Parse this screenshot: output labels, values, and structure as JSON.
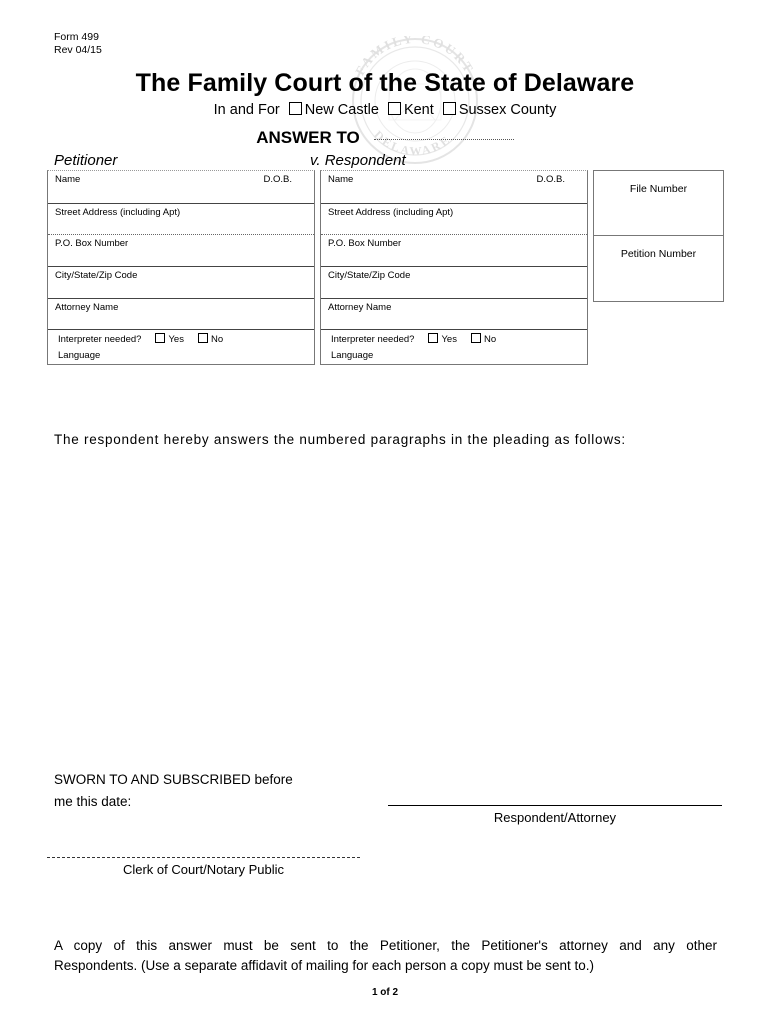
{
  "form": {
    "number": "Form 499",
    "revision": "Rev 04/15"
  },
  "header": {
    "title": "The Family Court of the State of Delaware",
    "county_prefix": "In and For",
    "counties": [
      "New Castle",
      "Kent",
      "Sussex County"
    ],
    "answer_to_label": "ANSWER TO",
    "seal_text_top": "FAMILY COURT",
    "seal_text_bottom": "DELAWARE"
  },
  "parties": {
    "petitioner_label": "Petitioner",
    "respondent_label": "v. Respondent",
    "fields": {
      "name": "Name",
      "dob": "D.O.B.",
      "street": "Street Address  (including Apt)",
      "po_box": "P.O. Box Number",
      "city_state_zip": "City/State/Zip Code",
      "attorney": "Attorney Name",
      "interpreter": "Interpreter needed?",
      "yes": "Yes",
      "no": "No",
      "language": "Language"
    }
  },
  "case_numbers": {
    "file_number": "File Number",
    "petition_number": "Petition Number"
  },
  "body": {
    "instruction": "The respondent hereby answers the numbered paragraphs in the pleading as follows:"
  },
  "signature": {
    "sworn_line1": "SWORN TO AND SUBSCRIBED before",
    "sworn_line2": "me this date:",
    "respondent_attorney": "Respondent/Attorney",
    "clerk": "Clerk of Court/Notary Public"
  },
  "notice": {
    "line1": "A copy of this answer must be sent to the Petitioner, the Petitioner's attorney and any other",
    "line2": "Respondents.  (Use a separate affidavit of mailing for each person a copy must be sent to.)"
  },
  "footer": {
    "page": "1 of 2"
  }
}
